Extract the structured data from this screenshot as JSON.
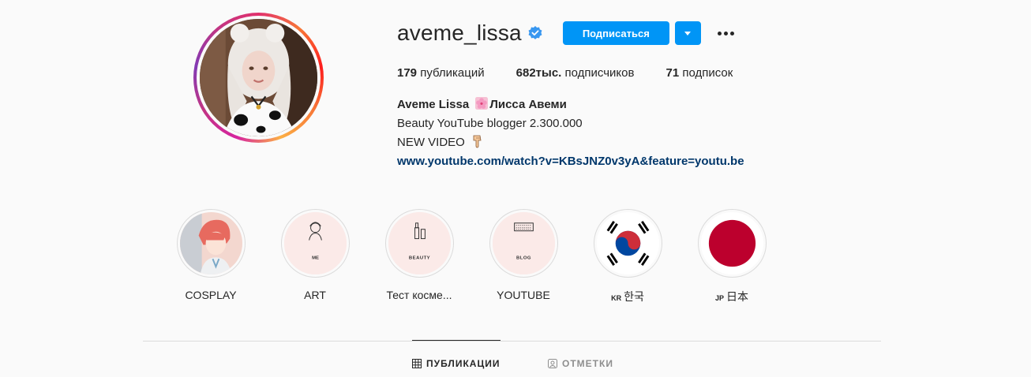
{
  "profile": {
    "username": "aveme_lissa",
    "follow_label": "Подписаться",
    "stats": {
      "posts_count": "179",
      "posts_label": "публикаций",
      "followers_count": "682тыс.",
      "followers_label": "подписчиков",
      "following_count": "71",
      "following_label": "подписок"
    },
    "bio": {
      "name": "Aveme Lissa",
      "name_suffix": "Лисса Авеми",
      "line1": "Beauty YouTube blogger 2.300.000",
      "line2": "NEW VIDEO",
      "link": "www.youtube.com/watch?v=KBsJNZ0v3yA&feature=youtu.be"
    }
  },
  "highlights": [
    {
      "label": "COSPLAY",
      "icon": "cosplay-anime-portrait"
    },
    {
      "label": "ART",
      "icon": "girl-sketch-icon",
      "caption": "ME"
    },
    {
      "label": "Тест космe...",
      "icon": "lipstick-icon",
      "caption": "BEAUTY"
    },
    {
      "label": "YOUTUBE",
      "icon": "keyboard-icon",
      "caption": "BLOG"
    },
    {
      "label_prefix": "KR",
      "label": "한국",
      "icon": "korea-flag"
    },
    {
      "label_prefix": "JP",
      "label": "日本",
      "icon": "japan-flag"
    }
  ],
  "tabs": [
    {
      "label": "ПУБЛИКАЦИИ",
      "icon": "grid-icon",
      "active": true
    },
    {
      "label": "ОТМЕТКИ",
      "icon": "tagged-user-icon",
      "active": false
    }
  ],
  "colors": {
    "accent": "#0095f6",
    "link": "#00376b",
    "verified": "#3897f0",
    "korea_red": "#cd2e3a",
    "korea_blue": "#0047a0",
    "japan_red": "#bc002d"
  }
}
